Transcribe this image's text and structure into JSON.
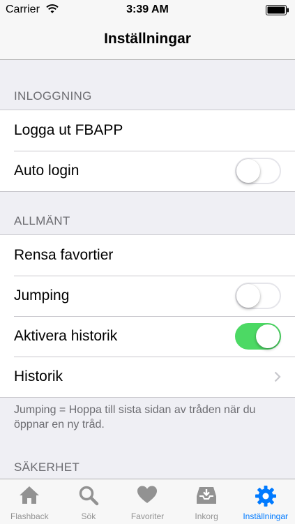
{
  "status_bar": {
    "carrier": "Carrier",
    "time": "3:39 AM"
  },
  "nav": {
    "title": "Inställningar"
  },
  "sections": {
    "login": {
      "header": "INLOGGNING",
      "logout_label": "Logga ut FBAPP",
      "autologin_label": "Auto login",
      "autologin_on": false
    },
    "general": {
      "header": "ALLMÄNT",
      "clear_favorites_label": "Rensa favortier",
      "jumping_label": "Jumping",
      "jumping_on": false,
      "history_enable_label": "Aktivera historik",
      "history_enable_on": true,
      "history_label": "Historik",
      "footer": "Jumping = Hoppa till sista sidan av tråden när du öppnar en ny tråd."
    },
    "security": {
      "header": "SÄKERHET"
    }
  },
  "tabs": [
    {
      "label": "Flashback",
      "icon": "home-icon"
    },
    {
      "label": "Sök",
      "icon": "search-icon"
    },
    {
      "label": "Favoriter",
      "icon": "heart-icon"
    },
    {
      "label": "Inkorg",
      "icon": "inbox-icon"
    },
    {
      "label": "Inställningar",
      "icon": "gear-icon",
      "active": true
    }
  ],
  "colors": {
    "accent": "#007aff",
    "toggle_on": "#4cd964",
    "background": "#efeff4",
    "secondary_text": "#6d6d72"
  }
}
